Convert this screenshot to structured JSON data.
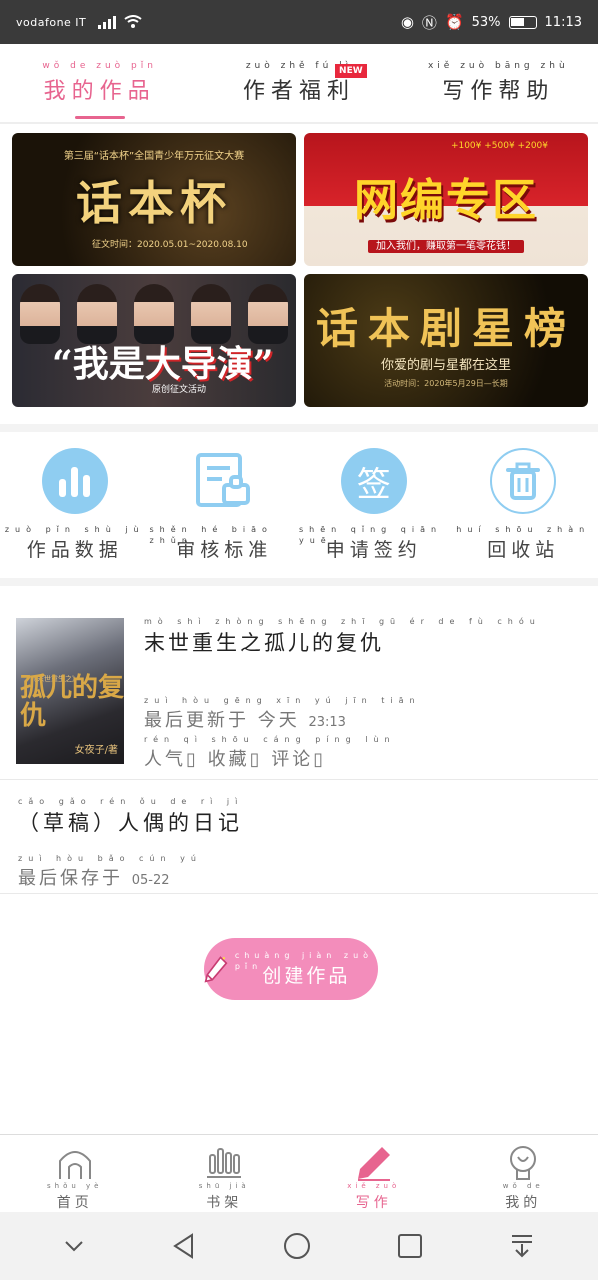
{
  "status_bar": {
    "carrier": "vodafone IT",
    "battery": "53%",
    "time": "11:13"
  },
  "top_tabs": [
    {
      "pinyin": "wǒ de zuò pǐn",
      "label": "我的作品",
      "active": true
    },
    {
      "pinyin": "zuò zhě fú lì",
      "label": "作者福利",
      "badge": "NEW"
    },
    {
      "pinyin": "xiě zuò bāng zhù",
      "label": "写作帮助"
    }
  ],
  "banners": {
    "b1": {
      "top": "第三届“话本杯”全国青少年万元征文大赛",
      "big": "话本杯",
      "sub": "征文时间：2020.05.01~2020.08.10"
    },
    "b2": {
      "money": "+100¥  +500¥  +200¥",
      "big": "网编专区",
      "sub": "加入我们，赚取第一笔零花钱！"
    },
    "b3": {
      "big_a": "“我是",
      "big_b": "大导演”",
      "sub": "原创征文活动"
    },
    "b4": {
      "big": "话本剧星榜",
      "sub": "你爱的剧与星都在这里",
      "date": "活动时间：2020年5月29日—长期"
    }
  },
  "tools": [
    {
      "pinyin": "zuò pǐn shù jù",
      "label": "作品数据",
      "icon": "bar-chart-icon"
    },
    {
      "pinyin": "shěn hé biāo zhǔn",
      "label": "审核标准",
      "icon": "document-stamp-icon"
    },
    {
      "pinyin": "shēn qǐng qiān yuē",
      "label": "申请签约",
      "icon": "sign-icon",
      "icon_text": "签"
    },
    {
      "pinyin": "huí shōu zhàn",
      "label": "回收站",
      "icon": "trash-icon"
    }
  ],
  "book": {
    "title_pinyin": "mò shì zhòng shēng zhī gū ér de fù chóu",
    "title": "末世重生之孤儿的复仇",
    "cover_title": "孤儿的复仇",
    "cover_tag": "《末世重生之》",
    "cover_author": "女夜子/著",
    "update_pinyin": "zuì hòu gēng xīn yú   jīn tiān",
    "update_label": "最后更新于 今天",
    "update_time": "23:13",
    "stats_pinyin": "rén qì   shōu cáng   píng lùn",
    "stats_label": "人气▯ 收藏▯ 评论▯"
  },
  "draft": {
    "title_pinyin": "cǎo gǎo   rén ǒu de rì jì",
    "title": "（草稿）人偶的日记",
    "saved_pinyin": "zuì hòu bǎo cún yú",
    "saved_label": "最后保存于",
    "saved_date": "05-22"
  },
  "create_button": {
    "pinyin": "chuàng jiàn zuò pǐn",
    "label": "创建作品"
  },
  "bottom_nav": [
    {
      "pinyin": "shǒu yè",
      "label": "首页",
      "icon": "home-icon"
    },
    {
      "pinyin": "shū jià",
      "label": "书架",
      "icon": "bookshelf-icon"
    },
    {
      "pinyin": "xiě zuò",
      "label": "写作",
      "icon": "pencil-icon",
      "active": true
    },
    {
      "pinyin": "wǒ de",
      "label": "我的",
      "icon": "profile-icon"
    }
  ],
  "colors": {
    "accent": "#e7648f",
    "icon_blue": "#8fcdf1",
    "create_pink": "#f38dbb"
  }
}
